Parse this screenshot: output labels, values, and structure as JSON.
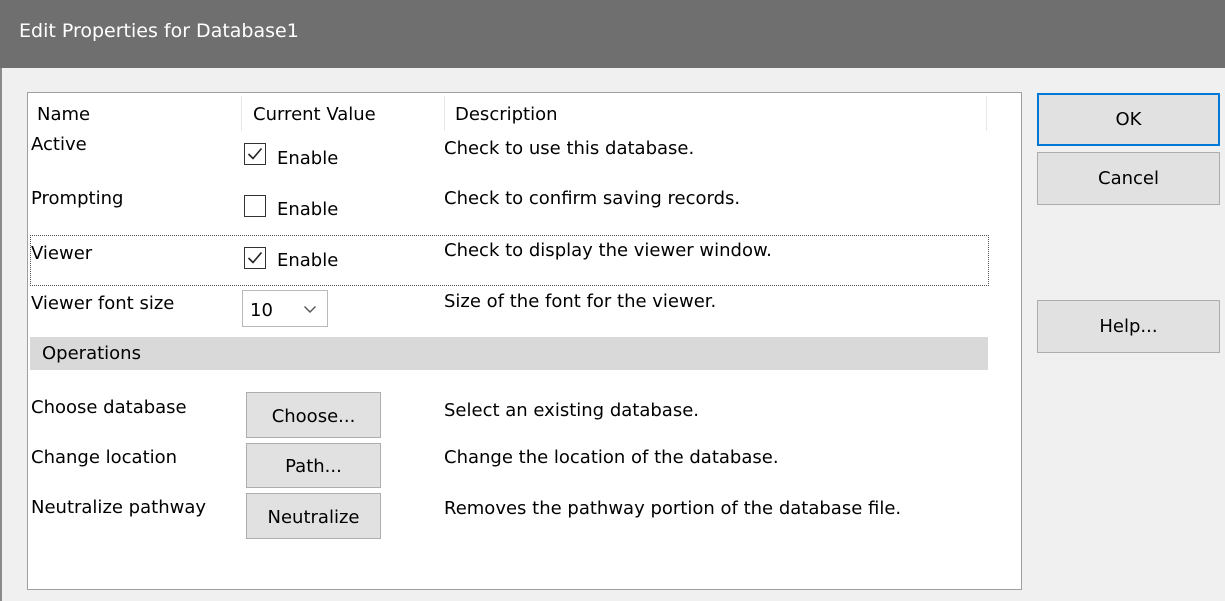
{
  "window": {
    "title": "Edit Properties for Database1"
  },
  "columns": {
    "name": "Name",
    "value": "Current Value",
    "description": "Description"
  },
  "rows": [
    {
      "name": "Active",
      "checked": true,
      "value_label": "Enable",
      "description": "Check to use this database."
    },
    {
      "name": "Prompting",
      "checked": false,
      "value_label": "Enable",
      "description": "Check to confirm saving records."
    },
    {
      "name": "Viewer",
      "checked": true,
      "value_label": "Enable",
      "description": "Check to display the viewer window."
    },
    {
      "name": "Viewer font size",
      "selected": "10",
      "description": "Size of the font for the viewer."
    }
  ],
  "section": {
    "label": "Operations"
  },
  "operations": [
    {
      "name": "Choose database",
      "button": "Choose...",
      "description": "Select an existing database."
    },
    {
      "name": "Change location",
      "button": "Path...",
      "description": "Change the location of the database."
    },
    {
      "name": "Neutralize pathway",
      "button": "Neutralize",
      "description": "Removes the pathway portion of the database file."
    }
  ],
  "buttons": {
    "ok": "OK",
    "cancel": "Cancel",
    "help": "Help..."
  },
  "colors": {
    "titlebar": "#6f6f6f",
    "accent": "#0078d7",
    "section": "#d9d9d9",
    "background": "#f0f0f0"
  }
}
